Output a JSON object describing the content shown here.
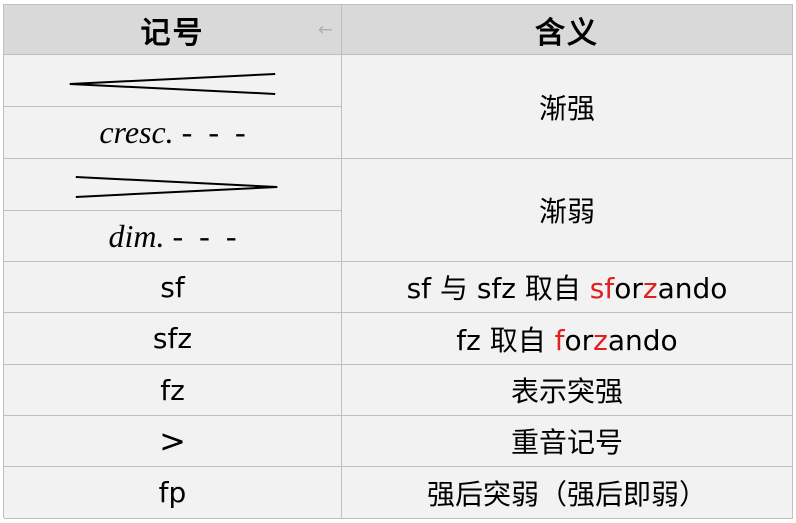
{
  "header": {
    "col1": "记号",
    "col2": "含义",
    "arrow_icon": "←"
  },
  "rows": {
    "cresc_text": "cresc. -  -  -",
    "cresc_meaning": "渐强",
    "dim_text": "dim. -  -  -",
    "dim_meaning": "渐弱",
    "sf_symbol": "sf",
    "sf_meaning": {
      "p1": "sf 与 sfz 取自 ",
      "p2": "sf",
      "p3": "or",
      "p4": "z",
      "p5": "ando"
    },
    "sfz_symbol": "sfz",
    "sfz_meaning": {
      "p1": "fz 取自 ",
      "p2": "f",
      "p3": "or",
      "p4": "z",
      "p5": "ando"
    },
    "fz_symbol": "fz",
    "fz_meaning": "表示突强",
    "accent_symbol": ">",
    "accent_meaning": "重音记号",
    "fp_symbol": "fp",
    "fp_meaning": "强后突弱（强后即弱）"
  },
  "colors": {
    "header_bg": "#d9d9d9",
    "row_bg": "#f2f2f2",
    "border": "#bfbfbf",
    "highlight": "#e02020"
  },
  "icons": {
    "crescendo": "crescendo-hairpin-icon",
    "diminuendo": "diminuendo-hairpin-icon"
  }
}
